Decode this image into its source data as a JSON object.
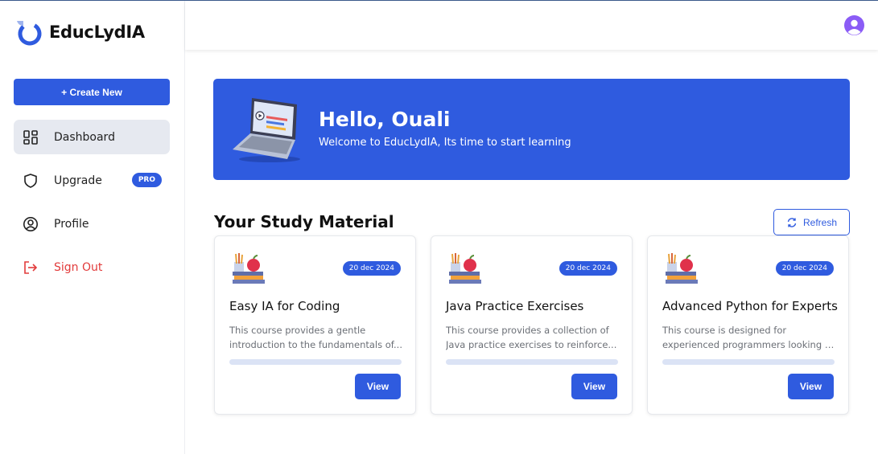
{
  "brand": {
    "name": "EducLydIA",
    "icon": "logo-ring-icon"
  },
  "sidebar": {
    "create_label": "+ Create New",
    "items": [
      {
        "label": "Dashboard",
        "icon": "dashboard-icon",
        "active": true
      },
      {
        "label": "Upgrade",
        "icon": "shield-icon",
        "badge": "PRO"
      },
      {
        "label": "Profile",
        "icon": "user-circle-icon"
      },
      {
        "label": "Sign Out",
        "icon": "sign-out-icon",
        "color": "#e23b3b"
      }
    ]
  },
  "header": {
    "avatar_icon": "user-avatar-icon"
  },
  "banner": {
    "title": "Hello, Ouali",
    "subtitle": "Welcome to EducLydIA, Its time to start learning",
    "icon": "laptop-icon"
  },
  "section": {
    "title": "Your Study Material",
    "refresh_label": "Refresh"
  },
  "cards": [
    {
      "date": "20 dec 2024",
      "title": "Easy IA for Coding",
      "desc1": "This course provides a gentle",
      "desc2": "introduction to the fundamentals of...",
      "progress": 0,
      "view_label": "View"
    },
    {
      "date": "20 dec 2024",
      "title": "Java Practice Exercises",
      "desc1": "This course provides a collection of",
      "desc2": "Java practice exercises to reinforce...",
      "progress": 0,
      "view_label": "View"
    },
    {
      "date": "20 dec 2024",
      "title": "Advanced Python for Experts",
      "desc1": "This course is designed for",
      "desc2": "experienced programmers looking t...",
      "progress": 0,
      "view_label": "View"
    }
  ],
  "colors": {
    "accent": "#2f5bdf",
    "danger": "#e23b3b",
    "progress_track": "#dbe3f5"
  }
}
